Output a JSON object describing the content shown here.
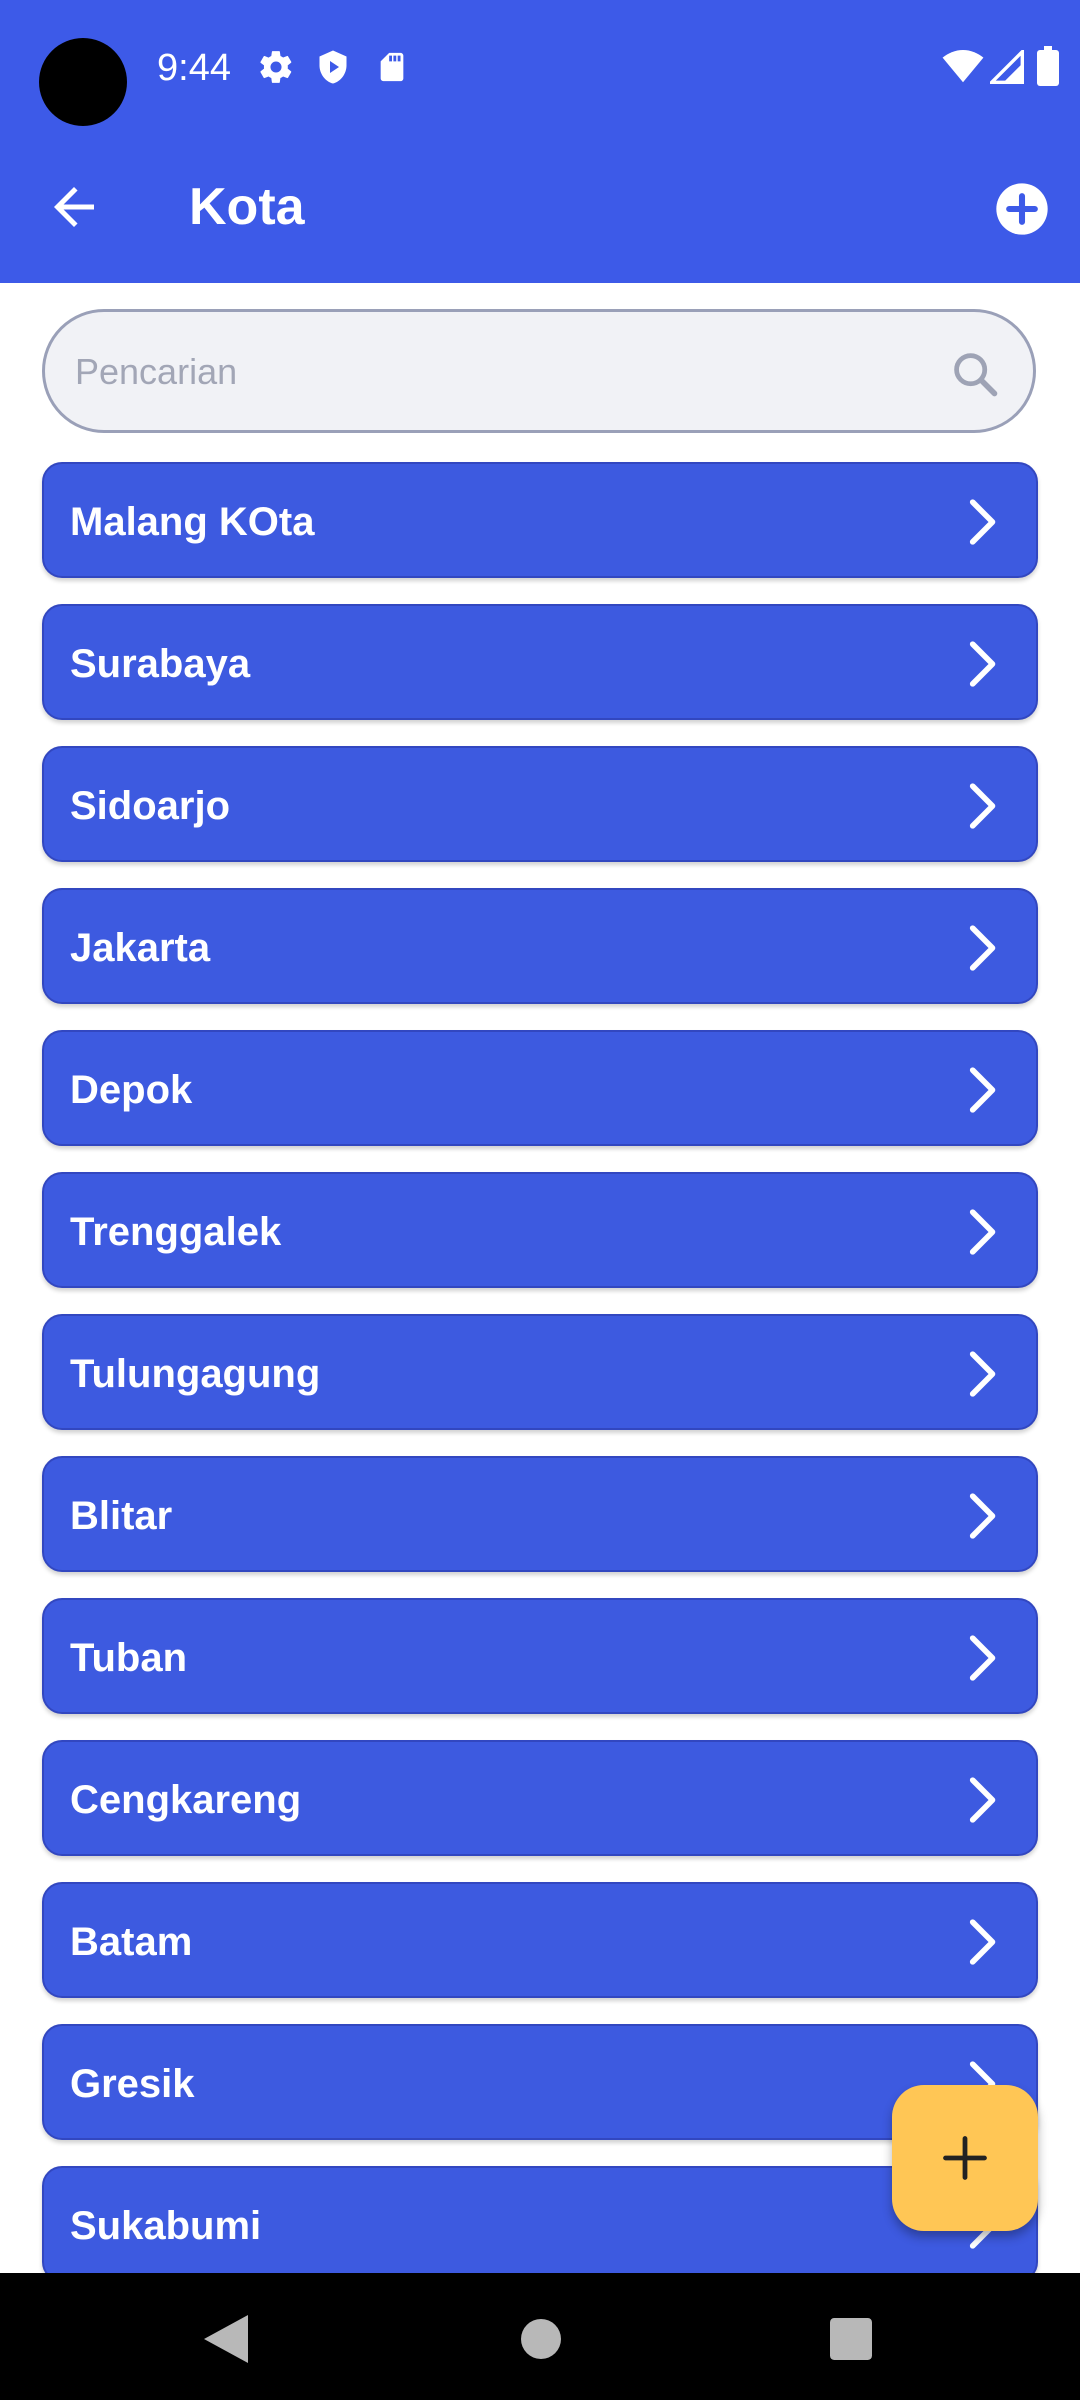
{
  "status_bar": {
    "time": "9:44",
    "left_icons": [
      "gear-icon",
      "shield-play-icon",
      "sd-card-icon"
    ],
    "right_icons": [
      "wifi-icon",
      "signal-icon",
      "battery-icon"
    ]
  },
  "toolbar": {
    "title": "Kota",
    "back_icon": "arrow-left-icon",
    "add_icon": "plus-circle-icon"
  },
  "search": {
    "placeholder": "Pencarian",
    "icon": "search-icon"
  },
  "cities": [
    {
      "name": "Malang KOta"
    },
    {
      "name": "Surabaya"
    },
    {
      "name": "Sidoarjo"
    },
    {
      "name": "Jakarta"
    },
    {
      "name": "Depok"
    },
    {
      "name": "Trenggalek"
    },
    {
      "name": "Tulungagung"
    },
    {
      "name": "Blitar"
    },
    {
      "name": "Tuban"
    },
    {
      "name": "Cengkareng"
    },
    {
      "name": "Batam"
    },
    {
      "name": "Gresik"
    },
    {
      "name": "Sukabumi"
    }
  ],
  "fab": {
    "icon": "plus-icon"
  },
  "nav_bar": {
    "icons": [
      "back-triangle-icon",
      "home-circle-icon",
      "recents-square-icon"
    ]
  },
  "colors": {
    "primary": "#3d5ae8",
    "list_item": "#3d5ae0",
    "fab": "#ffc655",
    "search_bg": "#f1f2f6"
  }
}
